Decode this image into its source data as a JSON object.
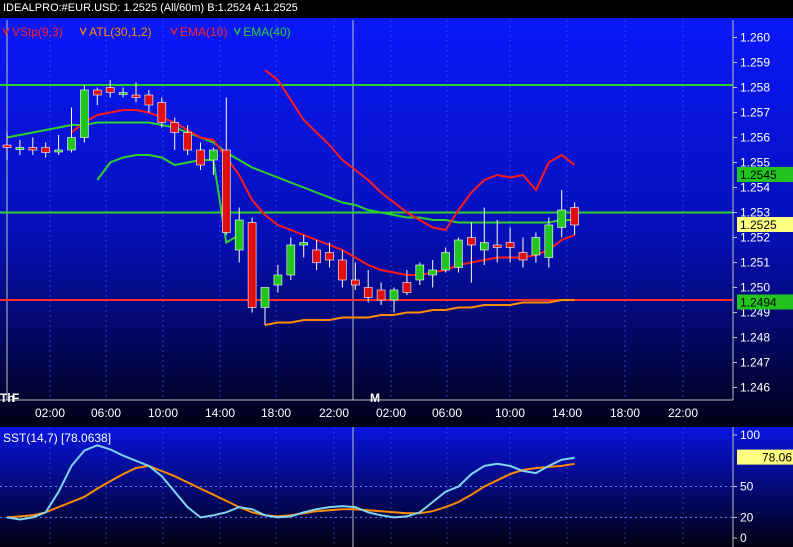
{
  "header": {
    "symbol": "IDEALPRO:#EUR.USD:",
    "last": "1.2525",
    "interval": "(All/60m)",
    "bid_label": "B:",
    "bid": "1.2524",
    "ask_label": "A:",
    "ask": "1.2525"
  },
  "indicators": [
    {
      "label": "VStp(9,3)",
      "color": "#ff2020"
    },
    {
      "label": "ATL(30,1,2)",
      "color": "#ff8c00"
    },
    {
      "label": "EMA(10)",
      "color": "#ff2020"
    },
    {
      "label": "EMA(40)",
      "color": "#2ed02e"
    }
  ],
  "colors": {
    "up": "#22c41e",
    "down": "#e01010",
    "ema10": "#ff1a1a",
    "ema40": "#2ed02e",
    "atl": "#ff8c00",
    "sst_fast": "#7fd4f0",
    "sst_slow": "#ff8c00"
  },
  "chart_data": {
    "type": "candlestick",
    "xlabel": "",
    "ylabel": "",
    "ylim": [
      1.2455,
      1.2607
    ],
    "yticks": [
      "1.260",
      "1.259",
      "1.258",
      "1.257",
      "1.256",
      "1.255",
      "1.254",
      "1.253",
      "1.252",
      "1.251",
      "1.250",
      "1.249",
      "1.248",
      "1.247",
      "1.246"
    ],
    "xticks": [
      "02:00",
      "06:00",
      "10:00",
      "14:00",
      "18:00",
      "22:00",
      "02:00",
      "06:00",
      "10:00",
      "14:00",
      "18:00",
      "22:00"
    ],
    "day_markers": [
      "Th",
      "F",
      "M"
    ],
    "hlines": [
      {
        "value": 1.2581,
        "color": "#2ed02e"
      },
      {
        "value": 1.253,
        "color": "#2ed02e"
      },
      {
        "value": 1.2495,
        "color": "#ff2a2a"
      }
    ],
    "price_labels": [
      {
        "text": "1.2545",
        "value": 1.2545,
        "bg": "#22c41e"
      },
      {
        "text": "1.2525",
        "value": 1.2525,
        "bg": "#ffff80"
      },
      {
        "text": "1.2494",
        "value": 1.2494,
        "bg": "#22c41e"
      }
    ],
    "candles": [
      {
        "o": 1.2557,
        "h": 1.2562,
        "l": 1.2551,
        "c": 1.2556
      },
      {
        "o": 1.2556,
        "h": 1.2559,
        "l": 1.2553,
        "c": 1.2556
      },
      {
        "o": 1.2556,
        "h": 1.256,
        "l": 1.2553,
        "c": 1.2555
      },
      {
        "o": 1.2556,
        "h": 1.2558,
        "l": 1.2552,
        "c": 1.2554
      },
      {
        "o": 1.2555,
        "h": 1.2561,
        "l": 1.2553,
        "c": 1.2555
      },
      {
        "o": 1.2555,
        "h": 1.2572,
        "l": 1.2554,
        "c": 1.256
      },
      {
        "o": 1.256,
        "h": 1.2581,
        "l": 1.2558,
        "c": 1.2579
      },
      {
        "o": 1.2579,
        "h": 1.258,
        "l": 1.2573,
        "c": 1.2577
      },
      {
        "o": 1.258,
        "h": 1.2583,
        "l": 1.2576,
        "c": 1.2578
      },
      {
        "o": 1.2578,
        "h": 1.258,
        "l": 1.2576,
        "c": 1.2578
      },
      {
        "o": 1.2577,
        "h": 1.2582,
        "l": 1.2574,
        "c": 1.2576
      },
      {
        "o": 1.2577,
        "h": 1.2579,
        "l": 1.257,
        "c": 1.2573
      },
      {
        "o": 1.2574,
        "h": 1.2576,
        "l": 1.2564,
        "c": 1.2566
      },
      {
        "o": 1.2566,
        "h": 1.2568,
        "l": 1.2555,
        "c": 1.2562
      },
      {
        "o": 1.2562,
        "h": 1.2565,
        "l": 1.2553,
        "c": 1.2555
      },
      {
        "o": 1.2555,
        "h": 1.2558,
        "l": 1.2547,
        "c": 1.2549
      },
      {
        "o": 1.2551,
        "h": 1.2556,
        "l": 1.2545,
        "c": 1.2555
      },
      {
        "o": 1.2555,
        "h": 1.2576,
        "l": 1.2521,
        "c": 1.2522
      },
      {
        "o": 1.2515,
        "h": 1.2532,
        "l": 1.251,
        "c": 1.2527
      },
      {
        "o": 1.2526,
        "h": 1.2528,
        "l": 1.249,
        "c": 1.2492
      },
      {
        "o": 1.2492,
        "h": 1.25,
        "l": 1.2485,
        "c": 1.25
      },
      {
        "o": 1.2501,
        "h": 1.2509,
        "l": 1.2498,
        "c": 1.2505
      },
      {
        "o": 1.2505,
        "h": 1.252,
        "l": 1.2503,
        "c": 1.2517
      },
      {
        "o": 1.2517,
        "h": 1.2521,
        "l": 1.2512,
        "c": 1.2518
      },
      {
        "o": 1.2515,
        "h": 1.2519,
        "l": 1.2507,
        "c": 1.251
      },
      {
        "o": 1.2514,
        "h": 1.2518,
        "l": 1.2508,
        "c": 1.2511
      },
      {
        "o": 1.2511,
        "h": 1.2515,
        "l": 1.25,
        "c": 1.2503
      },
      {
        "o": 1.2503,
        "h": 1.251,
        "l": 1.2499,
        "c": 1.2501
      },
      {
        "o": 1.25,
        "h": 1.2507,
        "l": 1.2494,
        "c": 1.2496
      },
      {
        "o": 1.2499,
        "h": 1.2502,
        "l": 1.2493,
        "c": 1.2495
      },
      {
        "o": 1.2495,
        "h": 1.25,
        "l": 1.249,
        "c": 1.2499
      },
      {
        "o": 1.2502,
        "h": 1.2507,
        "l": 1.2497,
        "c": 1.2498
      },
      {
        "o": 1.2503,
        "h": 1.251,
        "l": 1.2501,
        "c": 1.2509
      },
      {
        "o": 1.2505,
        "h": 1.2511,
        "l": 1.25,
        "c": 1.2507
      },
      {
        "o": 1.2507,
        "h": 1.2516,
        "l": 1.2506,
        "c": 1.2514
      },
      {
        "o": 1.2508,
        "h": 1.252,
        "l": 1.2506,
        "c": 1.2519
      },
      {
        "o": 1.252,
        "h": 1.2526,
        "l": 1.2502,
        "c": 1.2517
      },
      {
        "o": 1.2515,
        "h": 1.2532,
        "l": 1.2509,
        "c": 1.2518
      },
      {
        "o": 1.2517,
        "h": 1.2527,
        "l": 1.251,
        "c": 1.2516
      },
      {
        "o": 1.2518,
        "h": 1.2524,
        "l": 1.251,
        "c": 1.2516
      },
      {
        "o": 1.2514,
        "h": 1.252,
        "l": 1.2508,
        "c": 1.2511
      },
      {
        "o": 1.2513,
        "h": 1.2522,
        "l": 1.251,
        "c": 1.252
      },
      {
        "o": 1.2512,
        "h": 1.2528,
        "l": 1.2508,
        "c": 1.2525
      },
      {
        "o": 1.2524,
        "h": 1.2539,
        "l": 1.252,
        "c": 1.2531
      },
      {
        "o": 1.2532,
        "h": 1.2534,
        "l": 1.2521,
        "c": 1.2525
      }
    ],
    "ema10": [
      null,
      null,
      null,
      null,
      null,
      1.2562,
      1.2566,
      1.2569,
      1.257,
      1.2571,
      1.2571,
      1.257,
      1.2568,
      1.2566,
      1.2563,
      1.256,
      1.2559,
      1.2552,
      1.2545,
      1.2535,
      1.2529,
      1.2525,
      1.2523,
      1.2521,
      1.2519,
      1.2517,
      1.2515,
      1.2512,
      1.2509,
      1.2507,
      1.2506,
      1.2505,
      1.2505,
      1.2506,
      1.2507,
      1.2509,
      1.251,
      1.2511,
      1.2512,
      1.2512,
      1.2512,
      1.2513,
      1.2515,
      1.2519,
      1.2521
    ],
    "ema40": [
      1.256,
      1.2561,
      1.2562,
      1.2563,
      1.2564,
      1.2565,
      1.2565,
      1.2566,
      1.2566,
      1.2566,
      1.2566,
      1.2566,
      1.2565,
      1.2564,
      1.2562,
      1.256,
      1.2558,
      1.2554,
      1.2551,
      1.2548,
      1.2546,
      1.2544,
      1.2542,
      1.254,
      1.2538,
      1.2536,
      1.2534,
      1.2533,
      1.2531,
      1.253,
      1.2529,
      1.2528,
      1.2528,
      1.2527,
      1.2527,
      1.2526,
      1.2526,
      1.2526,
      1.2526,
      1.2526,
      1.2526,
      1.2526,
      1.2526,
      1.2527,
      1.2527
    ],
    "vstop": [
      null,
      null,
      null,
      null,
      null,
      null,
      null,
      null,
      null,
      null,
      null,
      null,
      null,
      null,
      null,
      null,
      null,
      null,
      null,
      null,
      1.2587,
      1.2583,
      1.2575,
      1.2567,
      1.2562,
      1.2557,
      1.2551,
      1.2547,
      1.2543,
      1.2538,
      1.2534,
      1.253,
      1.2527,
      1.2524,
      1.2523,
      1.2531,
      1.2538,
      1.2543,
      1.2545,
      1.2544,
      1.2545,
      1.2539,
      1.255,
      1.2553,
      1.2549
    ],
    "vstop2": [
      null,
      null,
      null,
      null,
      null,
      null,
      null,
      1.2543,
      1.255,
      1.2552,
      1.2553,
      1.2553,
      1.2552,
      1.2549,
      1.255,
      1.2551,
      1.2551,
      1.2518,
      1.2521,
      null,
      null,
      null,
      null,
      null,
      null,
      null,
      null,
      null,
      null,
      null,
      null,
      null,
      null,
      null,
      null,
      null,
      null,
      null,
      null,
      null,
      null,
      null,
      null,
      null,
      null
    ],
    "atl": [
      null,
      null,
      null,
      null,
      null,
      null,
      null,
      null,
      null,
      null,
      null,
      null,
      null,
      null,
      null,
      null,
      null,
      null,
      null,
      null,
      1.2485,
      1.2486,
      1.2486,
      1.2487,
      1.2487,
      1.2487,
      1.2488,
      1.2488,
      1.2488,
      1.2489,
      1.2489,
      1.249,
      1.249,
      1.2491,
      1.2491,
      1.2492,
      1.2492,
      1.2493,
      1.2493,
      1.2493,
      1.2494,
      1.2494,
      1.2494,
      1.2495,
      1.2495
    ],
    "oscillator": {
      "label": "SST(14,7)",
      "value_text": "[78.0638]",
      "value": 78.06,
      "ylim": [
        0,
        100
      ],
      "yticks": [
        "100",
        "78.06",
        "50",
        "20",
        "0"
      ],
      "k": [
        20,
        18,
        20,
        25,
        45,
        70,
        85,
        90,
        86,
        80,
        75,
        70,
        60,
        45,
        30,
        20,
        22,
        25,
        30,
        28,
        22,
        20,
        21,
        25,
        28,
        30,
        31,
        30,
        25,
        22,
        20,
        21,
        25,
        35,
        45,
        50,
        62,
        70,
        72,
        70,
        65,
        63,
        70,
        76,
        78
      ],
      "d": [
        20,
        21,
        22,
        25,
        30,
        35,
        40,
        48,
        55,
        62,
        68,
        70,
        65,
        60,
        54,
        48,
        42,
        36,
        30,
        25,
        22,
        21,
        22,
        24,
        26,
        27,
        28,
        28,
        27,
        26,
        25,
        24,
        24,
        26,
        30,
        35,
        42,
        50,
        56,
        62,
        66,
        68,
        69,
        70,
        72
      ]
    }
  }
}
